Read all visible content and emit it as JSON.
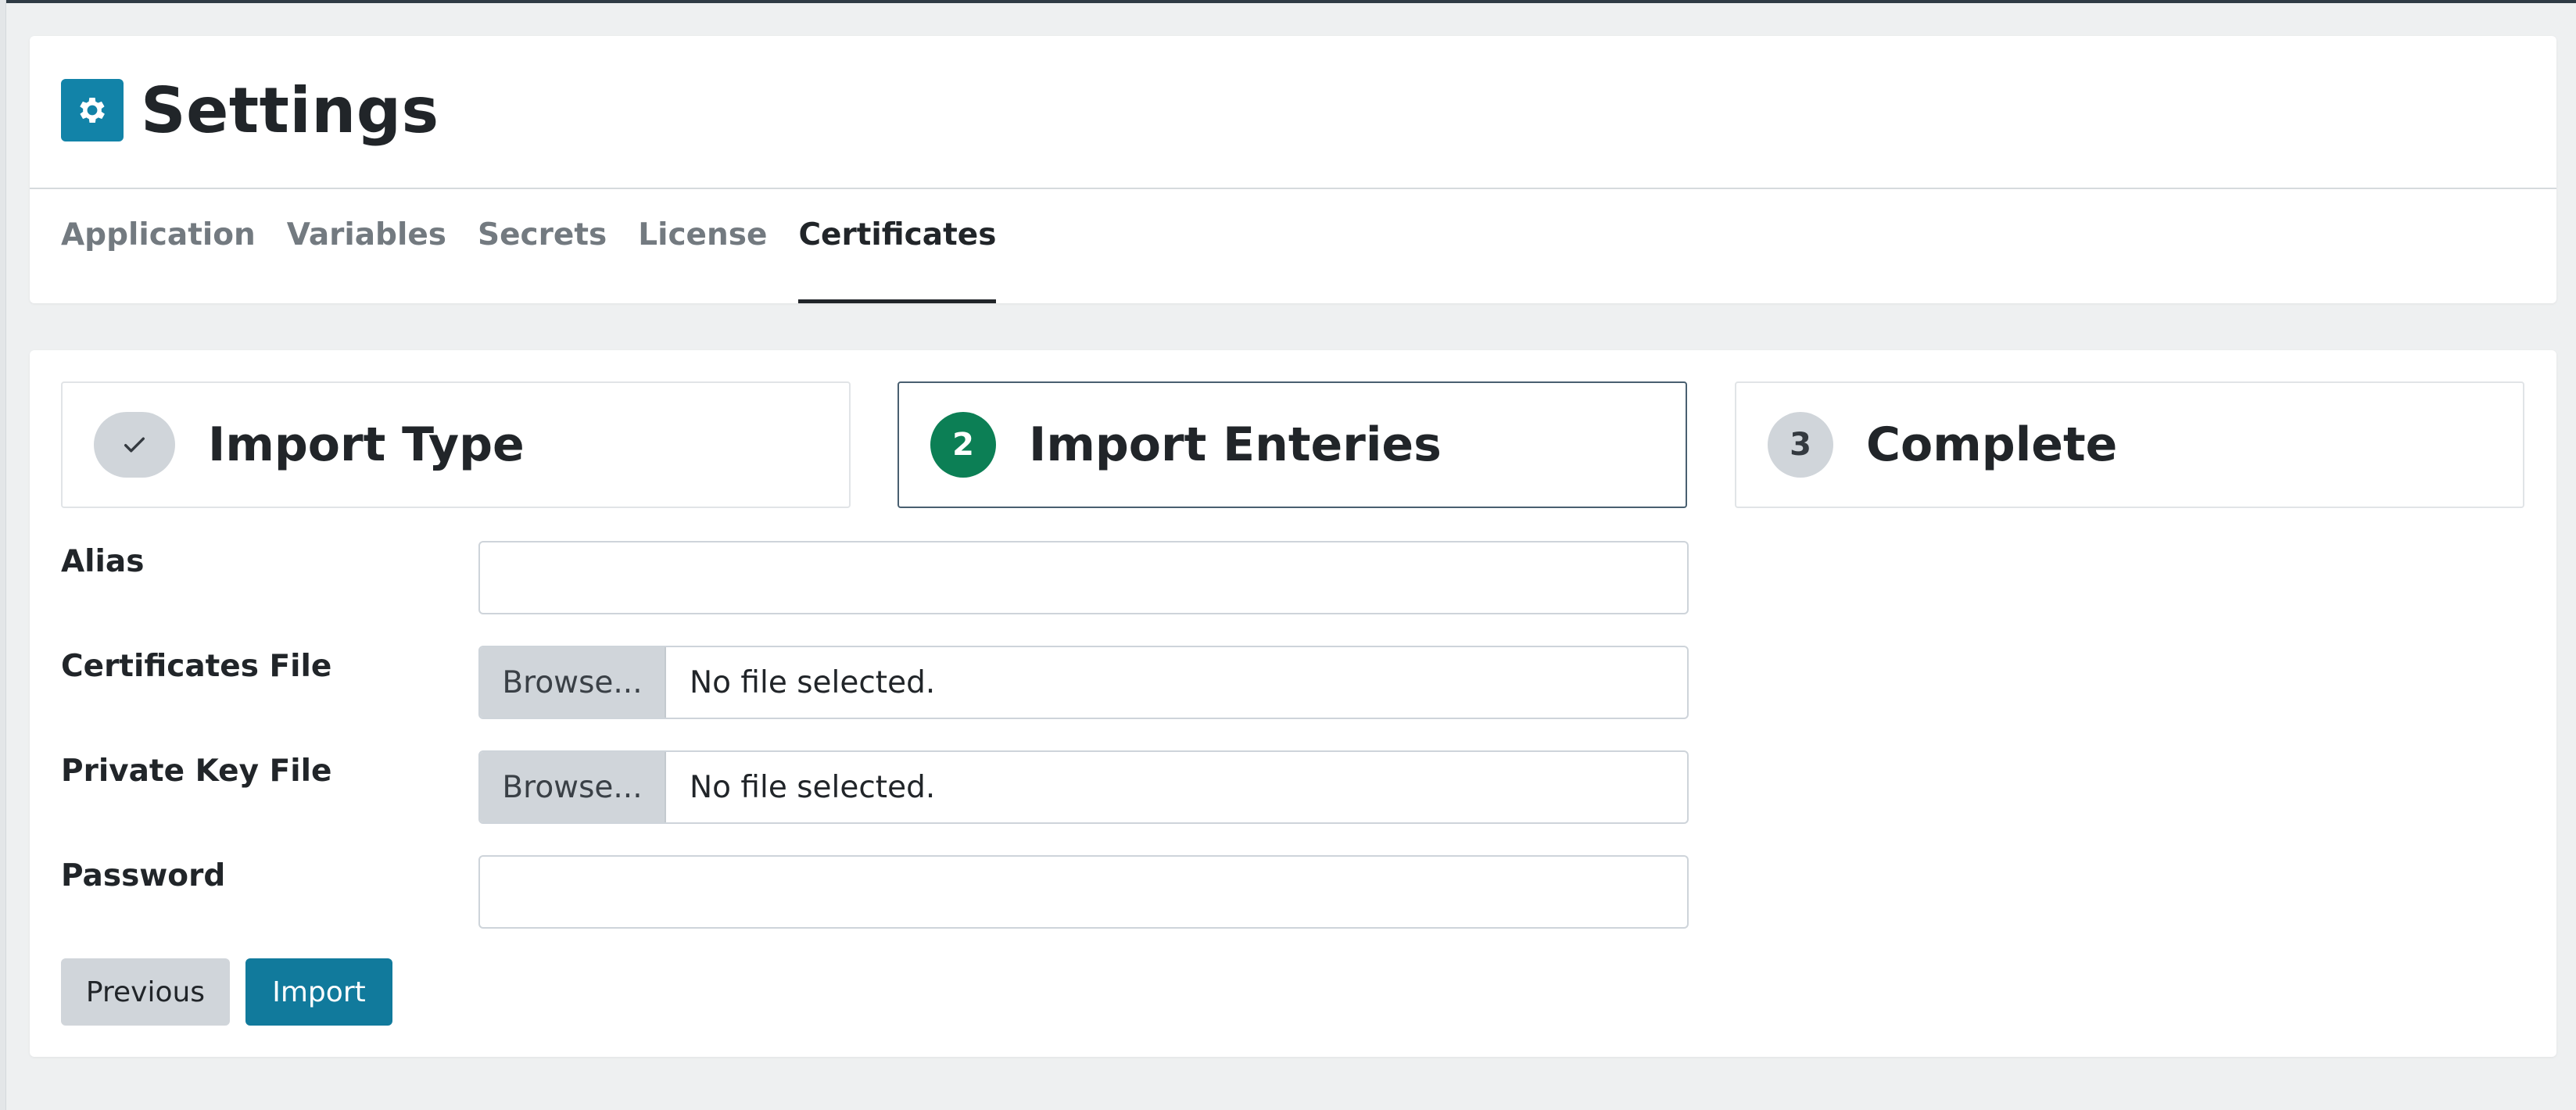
{
  "page": {
    "title": "Settings",
    "icon": "gear-icon",
    "accent_color": "#1283a8"
  },
  "tabs": [
    {
      "label": "Application",
      "active": false
    },
    {
      "label": "Variables",
      "active": false
    },
    {
      "label": "Secrets",
      "active": false
    },
    {
      "label": "License",
      "active": false
    },
    {
      "label": "Certificates",
      "active": true
    }
  ],
  "wizard": {
    "steps": [
      {
        "marker": "✓",
        "label": "Import Type",
        "state": "done"
      },
      {
        "marker": "2",
        "label": "Import Enteries",
        "state": "active"
      },
      {
        "marker": "3",
        "label": "Complete",
        "state": "pending"
      }
    ],
    "active_color": "#0c7f55"
  },
  "form": {
    "alias": {
      "label": "Alias",
      "value": ""
    },
    "certificates_file": {
      "label": "Certificates File",
      "browse_label": "Browse...",
      "status": "No file selected."
    },
    "private_key_file": {
      "label": "Private Key File",
      "browse_label": "Browse...",
      "status": "No file selected."
    },
    "password": {
      "label": "Password",
      "value": ""
    }
  },
  "actions": {
    "previous_label": "Previous",
    "import_label": "Import",
    "import_color": "#117a9c"
  }
}
